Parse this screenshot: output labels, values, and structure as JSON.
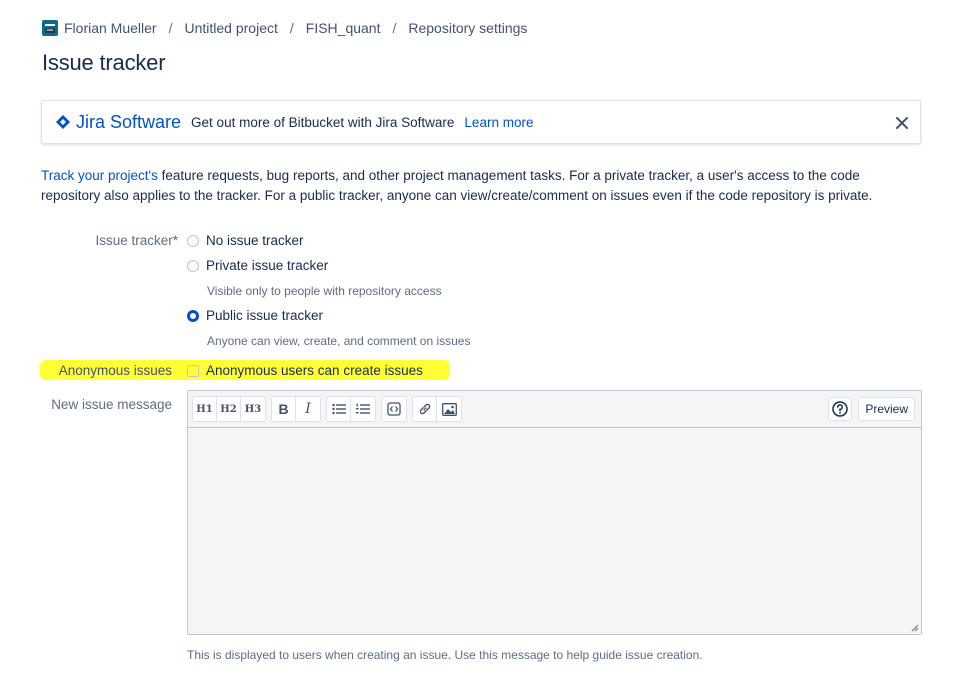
{
  "breadcrumb": {
    "items": [
      "Florian Mueller",
      "Untitled project",
      "FISH_quant",
      "Repository settings"
    ],
    "separator": "/"
  },
  "page_title": "Issue tracker",
  "banner": {
    "logo_text": "Jira Software",
    "text": "Get out more of Bitbucket with Jira Software",
    "learn_more": "Learn more",
    "close_icon": "close-icon"
  },
  "description": {
    "link": "Track your project's",
    "rest": " feature requests, bug reports, and other project management tasks. For a private tracker, a user's access to the code repository also applies to the tracker. For a public tracker, anyone can view/create/comment on issues even if the code repository is private."
  },
  "issue_tracker": {
    "label": "Issue tracker",
    "required_mark": "*",
    "options": [
      {
        "label": "No issue tracker",
        "checked": false,
        "help": ""
      },
      {
        "label": "Private issue tracker",
        "checked": false,
        "help": "Visible only to people with repository access"
      },
      {
        "label": "Public issue tracker",
        "checked": true,
        "help": "Anyone can view, create, and comment on issues"
      }
    ]
  },
  "anonymous": {
    "label": "Anonymous issues",
    "checkbox_label": "Anonymous users can create issues",
    "checked": false,
    "highlight_color": "#ffff33"
  },
  "new_issue_message": {
    "label": "New issue message",
    "toolbar": {
      "headings": [
        "H1",
        "H2",
        "H3"
      ],
      "bold": "B",
      "italic": "I",
      "preview": "Preview"
    },
    "value": "",
    "help": "This is displayed to users when creating an issue. Use this message to help guide issue creation."
  },
  "colors": {
    "link": "#0052cc",
    "text": "#172b4d",
    "muted": "#5e6c84",
    "required": "#de350b"
  }
}
